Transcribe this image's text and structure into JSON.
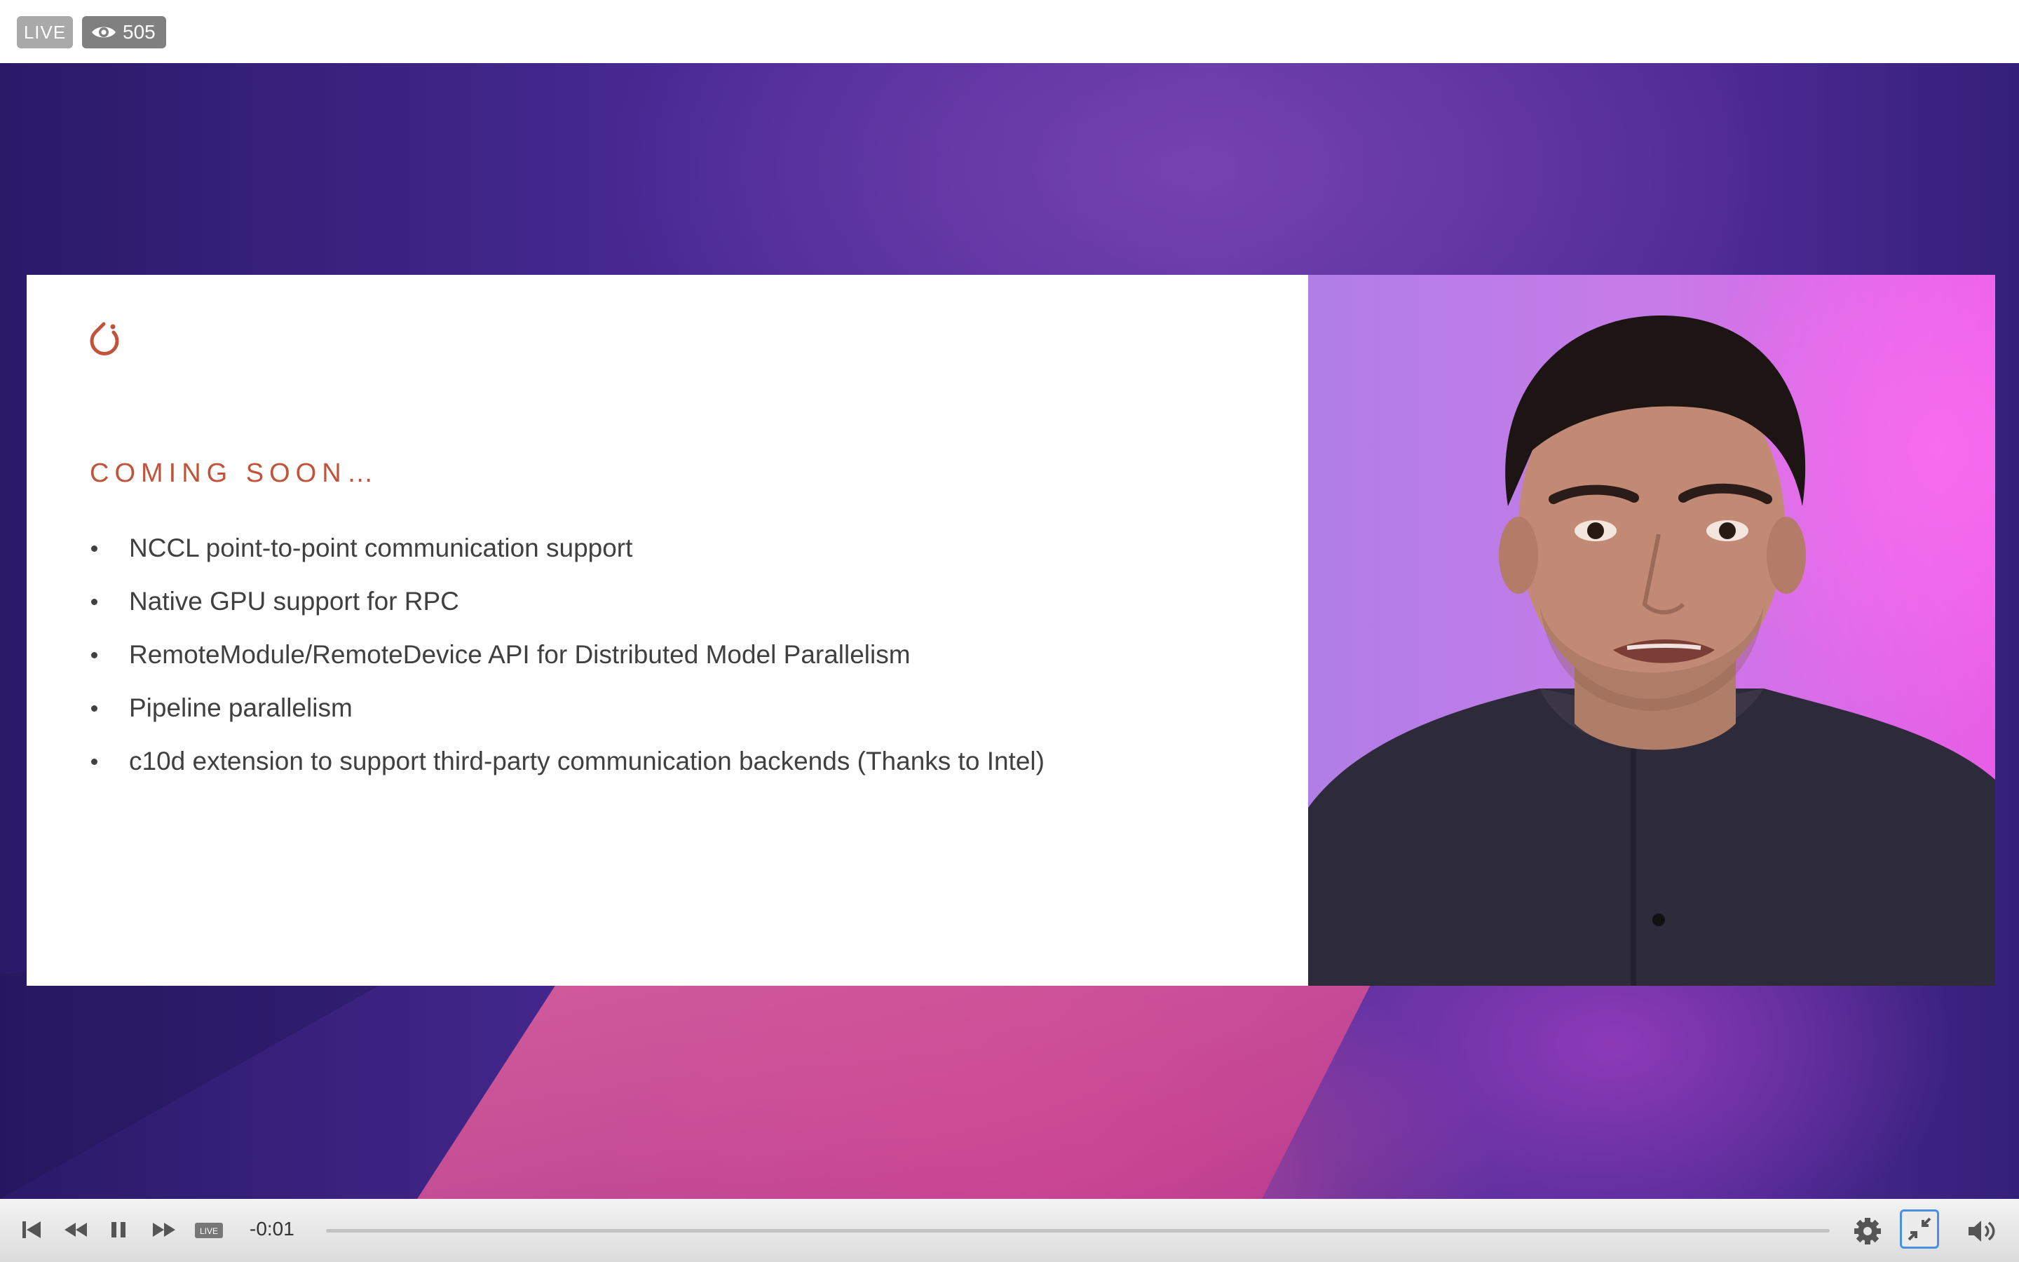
{
  "header": {
    "live_badge": "LIVE",
    "viewer_count": "505",
    "viewer_icon": "eye-icon"
  },
  "slide": {
    "logo_icon": "pytorch-flame-icon",
    "title": "COMING SOON…",
    "title_color": "#c0533a",
    "bullets": [
      "NCCL point-to-point communication support",
      "Native GPU support for RPC",
      "RemoteModule/RemoteDevice API for Distributed Model Parallelism",
      "Pipeline parallelism",
      "c10d extension to support third-party communication backends (Thanks to Intel)"
    ]
  },
  "controls": {
    "time": "-0:01",
    "live_label": "LIVE",
    "accent_color": "#4a90e2",
    "icons": [
      "skip-back-icon",
      "rewind-icon",
      "pause-icon",
      "fast-forward-icon",
      "live-icon",
      "settings-gear-icon",
      "exit-fullscreen-icon",
      "volume-icon"
    ]
  }
}
